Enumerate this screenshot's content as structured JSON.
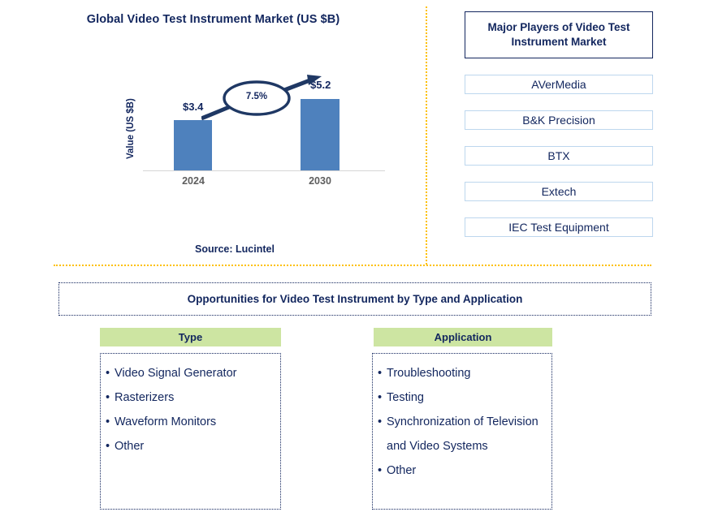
{
  "chart_panel": {
    "title": "Global Video Test Instrument Market (US $B)",
    "source": "Source: Lucintel"
  },
  "chart_data": {
    "type": "bar",
    "title": "Global Video Test Instrument Market (US $B)",
    "xlabel": "",
    "ylabel": "Value (US $B)",
    "categories": [
      "2024",
      "2030"
    ],
    "values": [
      3.4,
      5.2
    ],
    "data_labels": [
      "$3.4",
      "$5.2"
    ],
    "ylim": [
      0,
      6.0
    ],
    "grid": false,
    "legend": "none",
    "annotation": {
      "label": "7.5%",
      "meaning": "CAGR 2024-2030",
      "shape": "ellipse-with-arrow"
    },
    "colors": {
      "bar": "#4E81BD",
      "title_text": "#12265E",
      "tick_text": "#5E5E5E",
      "annotation_stroke": "#1F3864"
    }
  },
  "players": {
    "header": "Major Players of Video Test Instrument Market",
    "items": [
      "AVerMedia",
      "B&K Precision",
      "BTX",
      "Extech",
      "IEC Test Equipment"
    ],
    "border_color": "#BDD7EE"
  },
  "opportunities": {
    "banner": "Opportunities for Video Test Instrument by Type and Application",
    "bullet": "•",
    "columns": [
      {
        "header": "Type",
        "items": [
          "Video Signal Generator",
          "Rasterizers",
          "Waveform Monitors",
          "Other"
        ]
      },
      {
        "header": "Application",
        "items": [
          "Troubleshooting",
          "Testing",
          "Synchronization of Television and Video Systems",
          "Other"
        ]
      }
    ],
    "header_color": "#CDE5A2",
    "divider_color": "#FDC004"
  }
}
